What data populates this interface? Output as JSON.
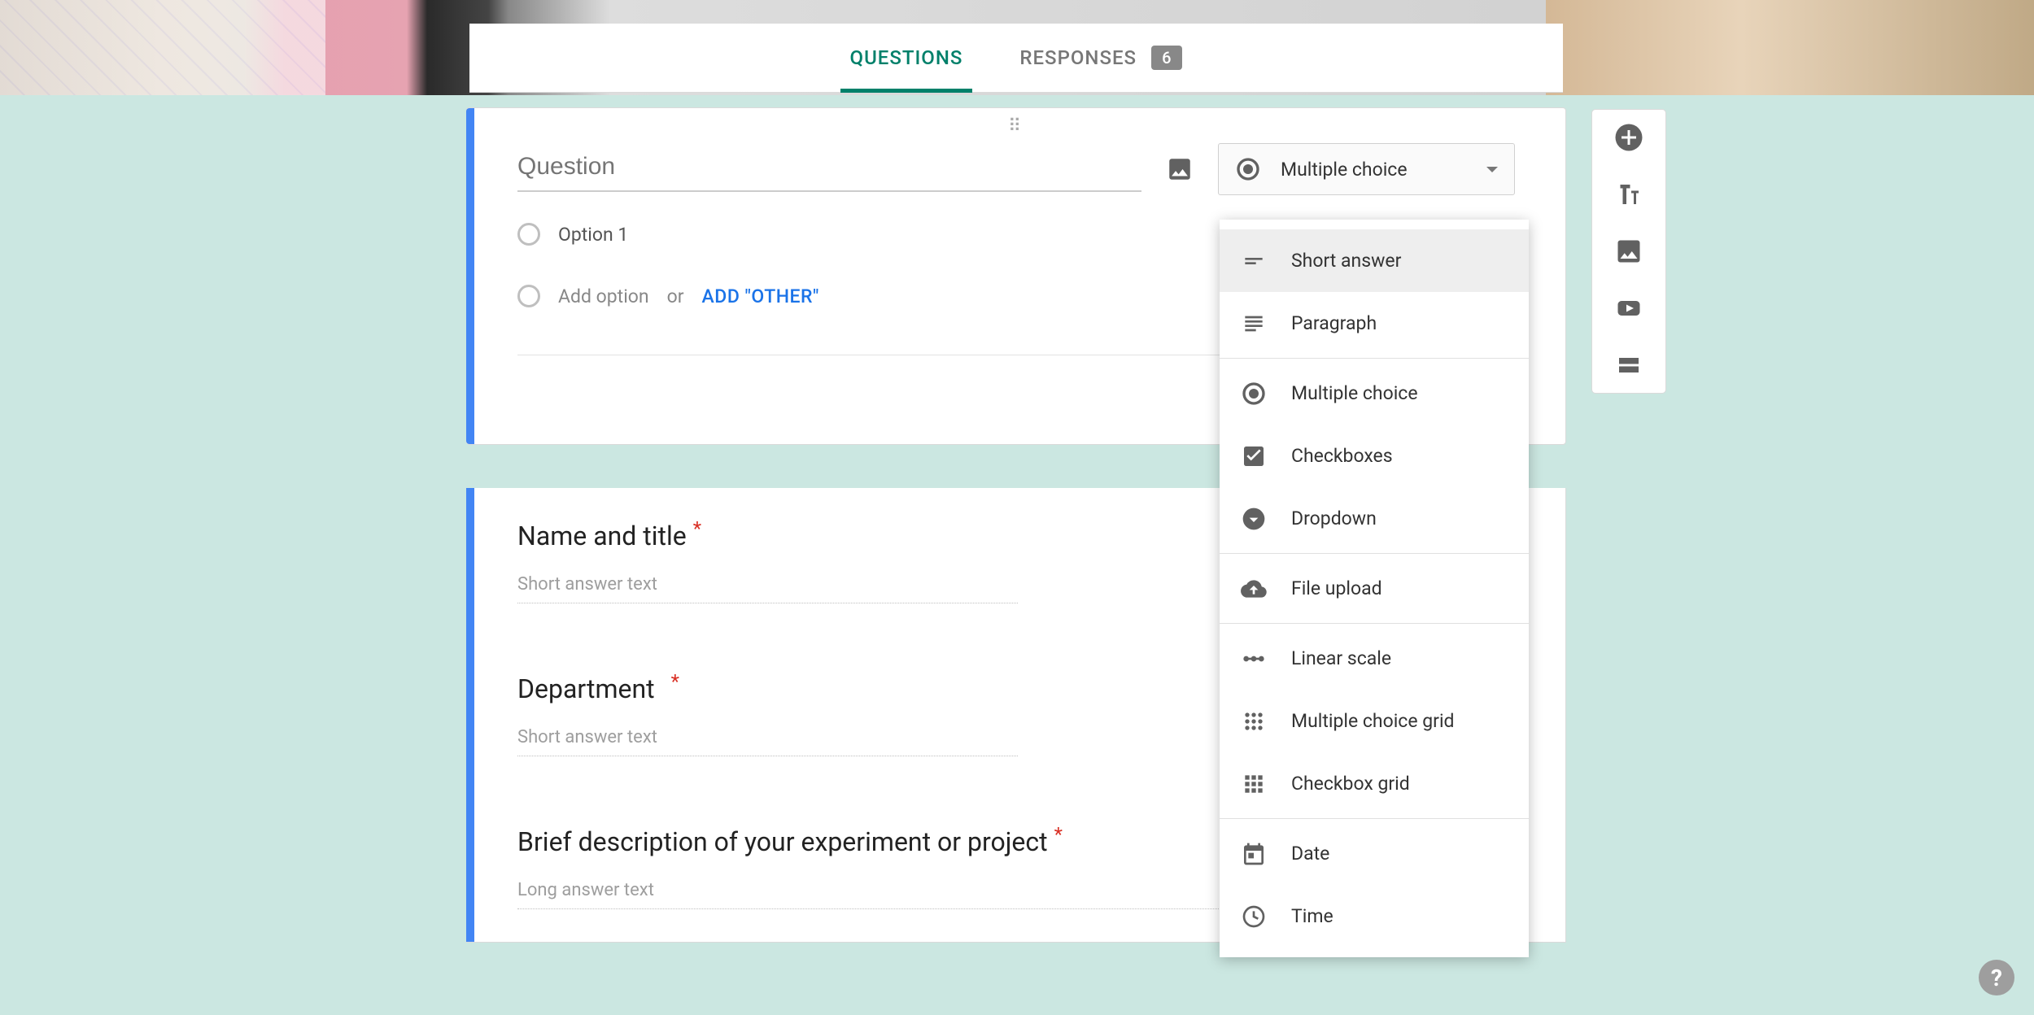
{
  "tabs": {
    "questions": "QUESTIONS",
    "responses": "RESPONSES",
    "response_count": "6"
  },
  "editor": {
    "question_placeholder": "Question",
    "selected_type": "Multiple choice",
    "option1": "Option 1",
    "add_option": "Add option",
    "or": "or",
    "add_other": "ADD \"OTHER\""
  },
  "type_menu": {
    "short_answer": "Short answer",
    "paragraph": "Paragraph",
    "multiple_choice": "Multiple choice",
    "checkboxes": "Checkboxes",
    "dropdown": "Dropdown",
    "file_upload": "File upload",
    "linear_scale": "Linear scale",
    "mc_grid": "Multiple choice grid",
    "cb_grid": "Checkbox grid",
    "date": "Date",
    "time": "Time"
  },
  "questions": {
    "q1_title": "Name and title",
    "q1_hint": "Short answer text",
    "q2_title": "Department",
    "q2_hint": "Short answer text",
    "q3_title": "Brief description of your experiment or project",
    "q3_hint": "Long answer text"
  }
}
